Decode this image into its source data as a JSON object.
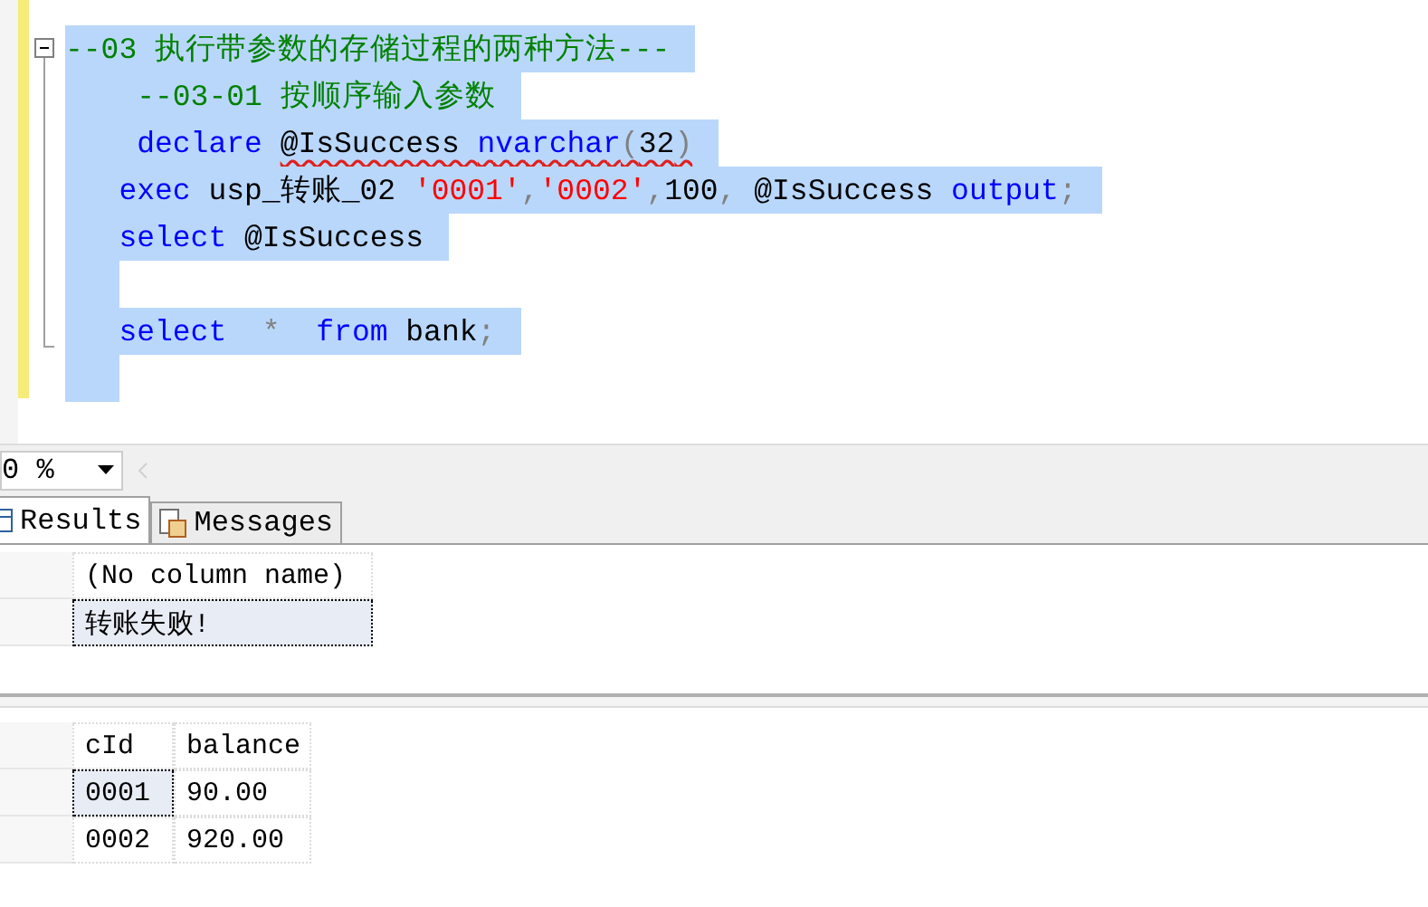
{
  "editor": {
    "lines": [
      {
        "selected": true,
        "tokens": [
          {
            "text": "--03 执行带参数的存储过程的两种方法---",
            "kind": "comment"
          }
        ]
      },
      {
        "selected": true,
        "tokens": [
          {
            "text": "    --03-01 按顺序输入参数",
            "kind": "comment"
          }
        ]
      },
      {
        "selected": true,
        "tokens": [
          {
            "text": "    declare ",
            "kind": "keyword"
          },
          {
            "text": "@IsSuccess ",
            "kind": "plain",
            "squiggle": true
          },
          {
            "text": "nvarchar",
            "kind": "keyword",
            "squiggle": true
          },
          {
            "text": "(",
            "kind": "punct",
            "squiggle": true
          },
          {
            "text": "32",
            "kind": "plain",
            "squiggle": true
          },
          {
            "text": ")",
            "kind": "punct",
            "squiggle": true
          }
        ]
      },
      {
        "selected": true,
        "tokens": [
          {
            "text": "   exec",
            "kind": "keyword"
          },
          {
            "text": " usp_转账_02 ",
            "kind": "plain"
          },
          {
            "text": "'0001'",
            "kind": "string"
          },
          {
            "text": ",",
            "kind": "punct"
          },
          {
            "text": "'0002'",
            "kind": "string"
          },
          {
            "text": ",",
            "kind": "punct"
          },
          {
            "text": "100",
            "kind": "plain"
          },
          {
            "text": ",",
            "kind": "punct"
          },
          {
            "text": " @IsSuccess ",
            "kind": "plain"
          },
          {
            "text": "output",
            "kind": "keyword"
          },
          {
            "text": ";",
            "kind": "punct"
          }
        ]
      },
      {
        "selected": true,
        "tokens": [
          {
            "text": "   select",
            "kind": "keyword"
          },
          {
            "text": " @IsSuccess",
            "kind": "plain"
          }
        ]
      },
      {
        "selected": true
      },
      {
        "selected": true,
        "tokens": [
          {
            "text": "   select",
            "kind": "keyword"
          },
          {
            "text": "  *  ",
            "kind": "punct"
          },
          {
            "text": "from",
            "kind": "keyword"
          },
          {
            "text": " bank",
            "kind": "plain"
          },
          {
            "text": ";",
            "kind": "punct"
          }
        ]
      },
      {
        "selected": true
      }
    ]
  },
  "zoom": {
    "value": "0 %"
  },
  "tabs": [
    {
      "label": "Results",
      "selected": true
    },
    {
      "label": "Messages",
      "selected": false
    }
  ],
  "grids": [
    {
      "columns": [
        "(No column name)"
      ],
      "rows": [
        {
          "cells": [
            "转账失败!"
          ],
          "selected": true
        }
      ]
    },
    {
      "columns": [
        "cId",
        "balance"
      ],
      "rows": [
        {
          "cells": [
            "0001",
            "90.00"
          ],
          "selected": true
        },
        {
          "cells": [
            "0002",
            "920.00"
          ],
          "selected": false
        }
      ]
    }
  ]
}
